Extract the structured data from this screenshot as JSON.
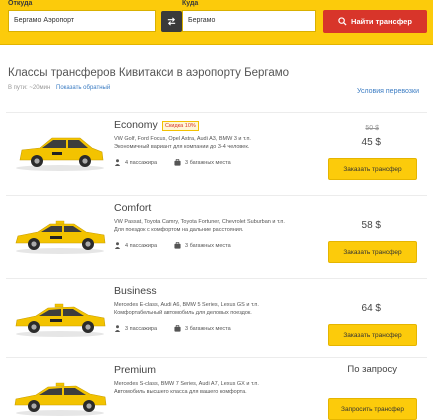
{
  "search": {
    "from_label": "Откуда",
    "from_value": "Бергамо Аэропорт",
    "to_label": "Куда",
    "to_value": "Бергамо",
    "submit_label": "Найти трансфер"
  },
  "page": {
    "title": "Классы трансферов Кивитакси в аэропорту Бергамо",
    "travel_time": "В пути: ~20мин",
    "reverse_link": "Показать обратный",
    "conditions_link": "Условия перевозки"
  },
  "classes": [
    {
      "name": "Economy",
      "promo": "Скидка 10%",
      "models": "VW Golf, Ford Focus, Opel Astra, Audi A3, BMW 3 и т.п.",
      "desc": "Экономичный вариант для компании до 3-4 человек.",
      "passengers": "4 пассажира",
      "bags": "3 багажных места",
      "old_price": "50 $",
      "price": "45 $",
      "button": "Заказать трансфер"
    },
    {
      "name": "Comfort",
      "models": "VW Passat, Toyota Camry, Toyota Fortuner, Chevrolet Suburban и т.п.",
      "desc": "Для поездок с комфортом на дальние расстояния.",
      "passengers": "4 пассажира",
      "bags": "3 багажных места",
      "price": "58 $",
      "button": "Заказать трансфер"
    },
    {
      "name": "Business",
      "models": "Mercedes E-class, Audi A6, BMW 5 Series, Lexus GS и т.п.",
      "desc": "Комфортабельный автомобиль для деловых поездок.",
      "passengers": "3 пассажира",
      "bags": "3 багажных места",
      "price": "64 $",
      "button": "Заказать трансфер"
    },
    {
      "name": "Premium",
      "models": "Mercedes S-class, BMW 7 Series, Audi A7, Lexus GX и т.п.",
      "desc": "Автомобиль высшего класса для вашего комфорта.",
      "price": "По запросу",
      "button": "Запросить трансфер"
    }
  ],
  "colors": {
    "accent_yellow": "#fccb0b",
    "button_red": "#d8352a",
    "link_blue": "#3b7cc3"
  }
}
